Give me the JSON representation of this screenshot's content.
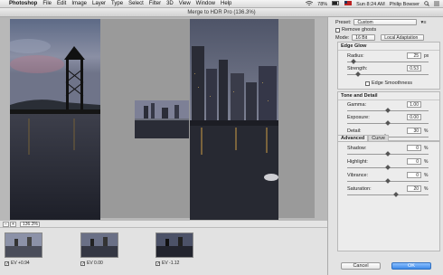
{
  "menubar": {
    "apple": "",
    "items": [
      "Photoshop",
      "File",
      "Edit",
      "Image",
      "Layer",
      "Type",
      "Select",
      "Filter",
      "3D",
      "View",
      "Window",
      "Help"
    ],
    "status": {
      "wifi": "",
      "battery": "78%",
      "flag": "",
      "time": "Sun 8:24 AM",
      "user": "Philip Bowser"
    }
  },
  "window": {
    "title": "Merge to HDR Pro (136.3%)"
  },
  "statusbar": {
    "zoom": "136.3%",
    "zoom_out": "−",
    "zoom_in": "+"
  },
  "thumbnails": [
    {
      "label": "EV +0.94",
      "checked": "✓"
    },
    {
      "label": "EV 0.00",
      "checked": "✓"
    },
    {
      "label": "EV -1.12",
      "checked": "✓"
    }
  ],
  "panel": {
    "preset_label": "Preset:",
    "preset_value": "Custom",
    "remove_ghosts": "Remove ghosts",
    "mode_label": "Mode:",
    "mode_value": "16 Bit",
    "method_value": "Local Adaptation",
    "edge_glow": {
      "title": "Edge Glow",
      "radius_label": "Radius:",
      "radius_value": "25",
      "radius_unit": "px",
      "radius_level": 0.08,
      "strength_label": "Strength:",
      "strength_value": "0.53",
      "strength_level": 0.13,
      "smoothness": "Edge Smoothness"
    },
    "tone_detail": {
      "title": "Tone and Detail",
      "gamma_label": "Gamma:",
      "gamma_value": "1.00",
      "gamma_level": 0.5,
      "exposure_label": "Exposure:",
      "exposure_value": "0.00",
      "exposure_level": 0.5,
      "detail_label": "Detail:",
      "detail_value": "30",
      "detail_unit": "%",
      "detail_level": 0.47
    },
    "tabs": {
      "advanced": "Advanced",
      "curve": "Curve"
    },
    "advanced": {
      "shadow_label": "Shadow:",
      "shadow_value": "0",
      "shadow_unit": "%",
      "shadow_level": 0.5,
      "highlight_label": "Highlight:",
      "highlight_value": "0",
      "highlight_unit": "%",
      "highlight_level": 0.5,
      "vibrance_label": "Vibrance:",
      "vibrance_value": "0",
      "vibrance_unit": "%",
      "vibrance_level": 0.5,
      "saturation_label": "Saturation:",
      "saturation_value": "20",
      "saturation_unit": "%",
      "saturation_level": 0.6
    },
    "cancel": "Cancel",
    "ok": "OK"
  }
}
